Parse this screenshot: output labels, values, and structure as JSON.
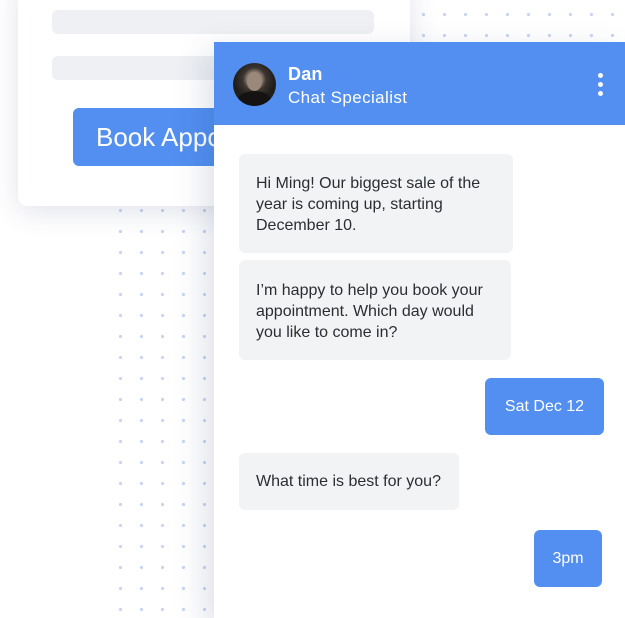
{
  "form": {
    "book_button_label": "Book Appointment"
  },
  "chat": {
    "agent_name": "Dan",
    "agent_role": "Chat Specialist",
    "messages": [
      {
        "sender": "agent",
        "text": "Hi Ming! Our biggest sale of the year is coming up, starting December 10."
      },
      {
        "sender": "agent",
        "text": "I’m happy to help you book your appointment. Which day would you like to come in?"
      },
      {
        "sender": "user",
        "text": "Sat Dec 12"
      },
      {
        "sender": "agent",
        "text": "What time is best for you?"
      },
      {
        "sender": "user",
        "text": "3pm"
      }
    ]
  },
  "icons": {
    "menu": "more-vertical-icon",
    "avatar": "user-photo"
  },
  "colors": {
    "accent": "#528ff0",
    "incoming_bubble": "#f2f3f5",
    "incoming_text": "#2a2e33",
    "placeholder_line": "#eef0f3",
    "dots": "#c7d3f3"
  }
}
